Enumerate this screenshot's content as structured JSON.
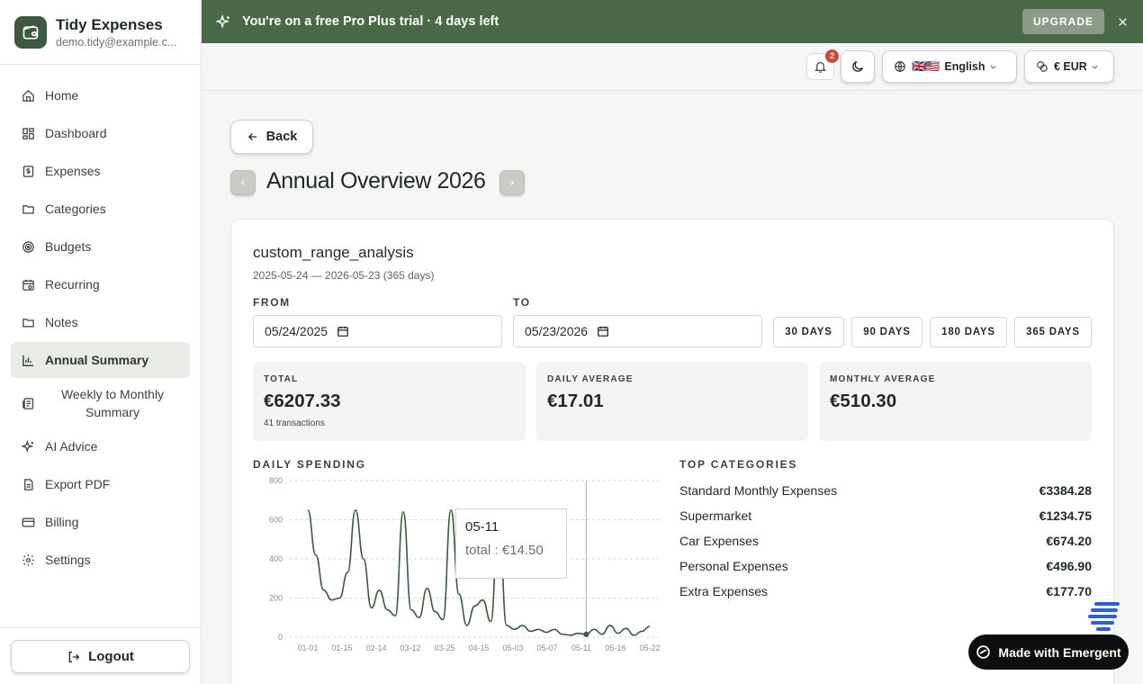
{
  "brand": {
    "title": "Tidy Expenses",
    "email": "demo.tidy@example.c..."
  },
  "sidebar": {
    "items": [
      {
        "label": "Home",
        "icon": "home-icon"
      },
      {
        "label": "Dashboard",
        "icon": "grid-icon"
      },
      {
        "label": "Expenses",
        "icon": "receipt-icon"
      },
      {
        "label": "Categories",
        "icon": "folder-icon"
      },
      {
        "label": "Budgets",
        "icon": "target-icon"
      },
      {
        "label": "Recurring",
        "icon": "calendar-repeat-icon"
      },
      {
        "label": "Notes",
        "icon": "note-icon"
      },
      {
        "label": "Annual Summary",
        "icon": "bar-chart-icon",
        "active": true
      },
      {
        "label": "Weekly to Monthly Summary",
        "icon": "report-icon"
      },
      {
        "label": "AI Advice",
        "icon": "sparkles-icon"
      },
      {
        "label": "Export PDF",
        "icon": "file-icon"
      },
      {
        "label": "Billing",
        "icon": "credit-card-icon"
      },
      {
        "label": "Settings",
        "icon": "gear-icon"
      }
    ],
    "logout_label": "Logout"
  },
  "banner": {
    "text": "You're on a free Pro Plus trial · 4 days left",
    "upgrade_label": "UPGRADE",
    "color": "#4a6a47"
  },
  "toolbar": {
    "notifications_count": "2",
    "language_flags": "🇬🇧🇺🇸",
    "language_label": "English",
    "currency_label": "€ EUR"
  },
  "main": {
    "back_label": "Back",
    "page_title": "Annual Overview 2026",
    "card": {
      "title": "custom_range_analysis",
      "subtitle": "2025-05-24 — 2026-05-23 (365 days)",
      "from_label": "FROM",
      "to_label": "TO",
      "from_value": "05/24/2025",
      "to_value": "05/23/2026",
      "ranges": [
        "30 DAYS",
        "90 DAYS",
        "180 DAYS",
        "365 DAYS"
      ],
      "stats": {
        "total_label": "TOTAL",
        "total_value": "€6207.33",
        "total_note": "41 transactions",
        "daily_label": "DAILY AVERAGE",
        "daily_value": "€17.01",
        "monthly_label": "MONTHLY AVERAGE",
        "monthly_value": "€510.30"
      },
      "daily_spending_label": "DAILY SPENDING",
      "top_categories_label": "TOP CATEGORIES",
      "top_categories": [
        {
          "name": "Standard Monthly Expenses",
          "amount": "€3384.28"
        },
        {
          "name": "Supermarket",
          "amount": "€1234.75"
        },
        {
          "name": "Car Expenses",
          "amount": "€674.20"
        },
        {
          "name": "Personal Expenses",
          "amount": "€496.90"
        },
        {
          "name": "Extra Expenses",
          "amount": "€177.70"
        }
      ],
      "tooltip": {
        "date": "05-11",
        "text": "total : €14.50"
      }
    }
  },
  "made_with": "Made with Emergent",
  "chart_data": {
    "type": "line",
    "title": "",
    "xlabel": "",
    "ylabel": "",
    "ylim": [
      0,
      800
    ],
    "yticks": [
      0,
      200,
      400,
      600,
      800
    ],
    "xticks": [
      "01-01",
      "01-15",
      "02-14",
      "03-12",
      "03-25",
      "04-15",
      "05-03",
      "05-07",
      "05-11",
      "05-16",
      "05-22"
    ],
    "grid": true,
    "line_color": "#3d5a40",
    "values": [
      650,
      420,
      240,
      190,
      200,
      330,
      650,
      400,
      150,
      240,
      140,
      110,
      640,
      140,
      100,
      250,
      130,
      90,
      650,
      220,
      60,
      160,
      190,
      80,
      620,
      60,
      40,
      60,
      30,
      40,
      25,
      40,
      15,
      10,
      20,
      14.5,
      40,
      15,
      60,
      20,
      45,
      10,
      30,
      55
    ],
    "highlight": {
      "x": "05-11",
      "value": 14.5
    }
  }
}
